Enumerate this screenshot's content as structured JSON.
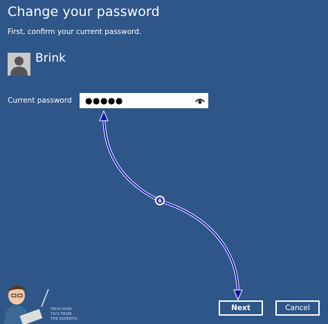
{
  "dialog": {
    "title": "Change your password",
    "subtitle": "First, confirm your current password."
  },
  "user": {
    "name": "Brink",
    "avatar_icon": "user-silhouette-icon"
  },
  "password": {
    "label": "Current password",
    "value": "●●●●●",
    "reveal_icon": "eye-icon"
  },
  "buttons": {
    "next": "Next",
    "cancel": "Cancel"
  },
  "annotation": {
    "step_number": "6",
    "arrow_color": "#1414b4"
  },
  "watermark": {
    "text": "TECH HOW-TO'S FROM THE EXPERTS!"
  },
  "colors": {
    "background": "#2e5688",
    "text": "#ffffff",
    "field": "#ffffff"
  }
}
